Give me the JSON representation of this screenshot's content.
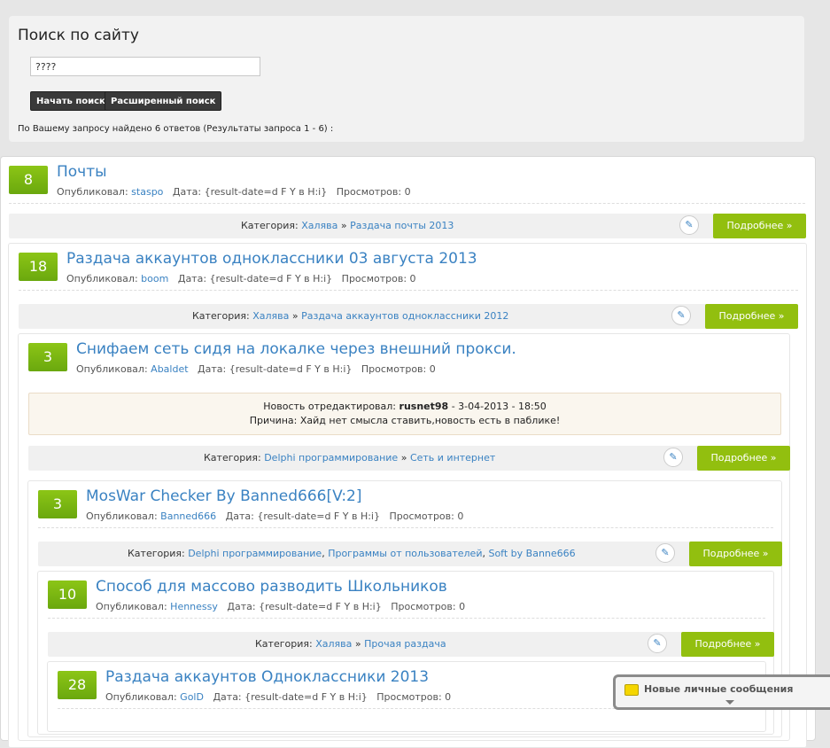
{
  "search": {
    "title": "Поиск по сайту",
    "query_value": "????",
    "start_button": "Начать поиск",
    "advanced_button": "Расширенный поиск",
    "result_text": "По Вашему запросу найдено 6 ответов (Результаты запроса 1 - 6) :"
  },
  "labels": {
    "published_by": "Опубликовал:",
    "date": "Дата: {result-date=d F Y в H:i}",
    "views": "Просмотров: 0",
    "category": "Категория:",
    "more": "Подробнее »",
    "edit_icon": "pencil-icon"
  },
  "posts": [
    {
      "rating": "8",
      "title": "Почты",
      "author": "staspo",
      "categories": [
        {
          "text": "Халява"
        },
        {
          "sep": " » "
        },
        {
          "text": "Раздача почты 2013"
        }
      ]
    },
    {
      "rating": "18",
      "title": "Раздача аккаунтов одноклассники 03 августа 2013",
      "author": "boom",
      "categories": [
        {
          "text": "Халява"
        },
        {
          "sep": " » "
        },
        {
          "text": "Раздача аккаунтов одноклассники 2012"
        }
      ]
    },
    {
      "rating": "3",
      "title": "Снифаем сеть сидя на локалке через внешний прокси.",
      "author": "Abaldet",
      "notice": {
        "edited_label": "Новость отредактировал:",
        "editor": "rusnet98",
        "edited_date": "- 3-04-2013 - 18:50",
        "reason": "Причина: Хайд нет смысла ставить,новость есть в паблике!"
      },
      "categories": [
        {
          "text": "Delphi программирование"
        },
        {
          "sep": " » "
        },
        {
          "text": "Сеть и интернет"
        }
      ]
    },
    {
      "rating": "3",
      "title": "MosWar Checker By Banned666[V:2]",
      "author": "Banned666",
      "categories": [
        {
          "text": "Delphi программирование"
        },
        {
          "sep": ", "
        },
        {
          "text": "Программы от пользователей"
        },
        {
          "sep": ", "
        },
        {
          "text": "Soft by Banne666"
        }
      ]
    },
    {
      "rating": "10",
      "title": "Способ для массово разводить Школьников",
      "author": "Hennessy",
      "categories": [
        {
          "text": "Халява"
        },
        {
          "sep": " » "
        },
        {
          "text": "Прочая раздача"
        }
      ]
    },
    {
      "rating": "28",
      "title": "Раздача аккаунтов Одноклассники 2013",
      "author": "GolD"
    }
  ],
  "pm": {
    "label": "Новые личные сообщения"
  },
  "colors": {
    "accent": "#92bf0f",
    "link": "#3a82c2"
  }
}
